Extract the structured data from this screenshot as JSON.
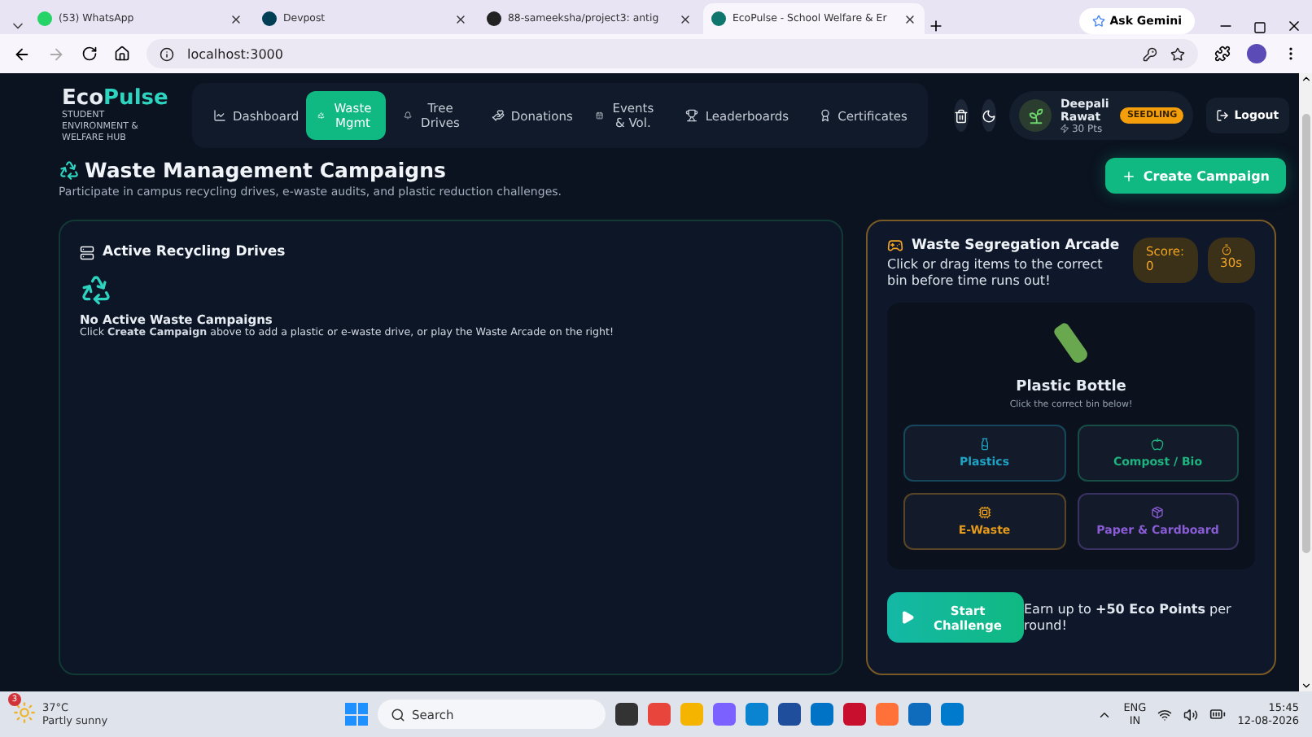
{
  "browser": {
    "tabs": [
      {
        "kind": "whatsapp",
        "label": "(53) WhatsApp",
        "selected": false
      },
      {
        "kind": "devpost",
        "label": "Devpost",
        "selected": false
      },
      {
        "kind": "github",
        "label": "88-sameeksha/project3: antig",
        "selected": false
      },
      {
        "kind": "app",
        "label": "EcoPulse - School Welfare & Er",
        "selected": true
      }
    ],
    "gemini_button": "Ask Gemini",
    "address": "localhost:3000"
  },
  "app": {
    "logo": {
      "name_start": "Eco",
      "name_accent": "Pulse",
      "tagline": "STUDENT ENVIRONMENT & WELFARE HUB"
    },
    "nav": [
      {
        "kind": "dashboard",
        "label": "Dashboard",
        "selected": false
      },
      {
        "kind": "waste",
        "label": "Waste Mgmt",
        "selected": true
      },
      {
        "kind": "tree",
        "label": "Tree Drives",
        "selected": false
      },
      {
        "kind": "donations",
        "label": "Donations",
        "selected": false
      },
      {
        "kind": "events",
        "label": "Events & Vol.",
        "selected": false
      },
      {
        "kind": "leaderboards",
        "label": "Leaderboards",
        "selected": false
      },
      {
        "kind": "certificates",
        "label": "Certificates",
        "selected": false
      }
    ],
    "user": {
      "name": "Deepali Rawat",
      "points": "30 Pts",
      "badge": "SEEDLING"
    },
    "logout": "Logout"
  },
  "page": {
    "title": "Waste Management Campaigns",
    "subtitle": "Participate in campus recycling drives, e-waste audits, and plastic reduction challenges.",
    "create_button": "Create Campaign"
  },
  "drives": {
    "title": "Active Recycling Drives",
    "empty_title": "No Active Waste Campaigns",
    "empty_text": "Click **Create Campaign** above to add a plastic or e-waste drive, or play the Waste Arcade on the right!"
  },
  "arcade": {
    "title": "Waste Segregation Arcade",
    "description": "Click or drag items to the correct bin before time runs out!",
    "score_label": "Score:",
    "score": "0",
    "timer": "30s",
    "item": "Plastic Bottle",
    "hint": "Click the correct bin below!",
    "bins": [
      {
        "kind": "plastic",
        "label": "Plastics",
        "color": "#1fa3c4"
      },
      {
        "kind": "compost",
        "label": "Compost / Bio",
        "color": "#1db47f"
      },
      {
        "kind": "ewaste",
        "label": "E-Waste",
        "color": "#e59a1b"
      },
      {
        "kind": "paper",
        "label": "Paper & Cardboard",
        "color": "#8a5cd6"
      }
    ],
    "start_button": "Start Challenge",
    "reward": "Earn up to **+50 Eco Points** per round!"
  },
  "taskbar": {
    "notification_count": "3",
    "temperature": "37°C",
    "weather": "Partly sunny",
    "search": "Search",
    "language": "ENG",
    "region": "IN",
    "time": "15:45",
    "date": "12-08-2026"
  }
}
